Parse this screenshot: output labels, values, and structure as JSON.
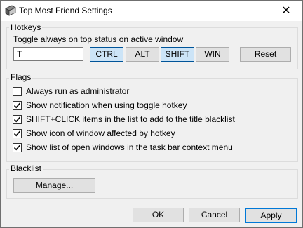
{
  "window": {
    "title": "Top Most Friend Settings",
    "close_glyph": "✕",
    "icon": "app-icon"
  },
  "hotkeys": {
    "group_label": "Hotkeys",
    "description": "Toggle always on top status on active window",
    "key_value": "T",
    "modifiers": [
      {
        "label": "CTRL",
        "pressed": true
      },
      {
        "label": "ALT",
        "pressed": false
      },
      {
        "label": "SHIFT",
        "pressed": true
      },
      {
        "label": "WIN",
        "pressed": false
      }
    ],
    "reset_label": "Reset"
  },
  "flags": {
    "group_label": "Flags",
    "items": [
      {
        "label": "Always run as administrator",
        "checked": false
      },
      {
        "label": "Show notification when using toggle hotkey",
        "checked": true
      },
      {
        "label": "SHIFT+CLICK items in the list to add to the title blacklist",
        "checked": true
      },
      {
        "label": "Show icon of window affected by hotkey",
        "checked": true
      },
      {
        "label": "Show list of open windows in the task bar context menu",
        "checked": true
      }
    ]
  },
  "blacklist": {
    "group_label": "Blacklist",
    "manage_label": "Manage..."
  },
  "footer": {
    "ok_label": "OK",
    "cancel_label": "Cancel",
    "apply_label": "Apply"
  }
}
